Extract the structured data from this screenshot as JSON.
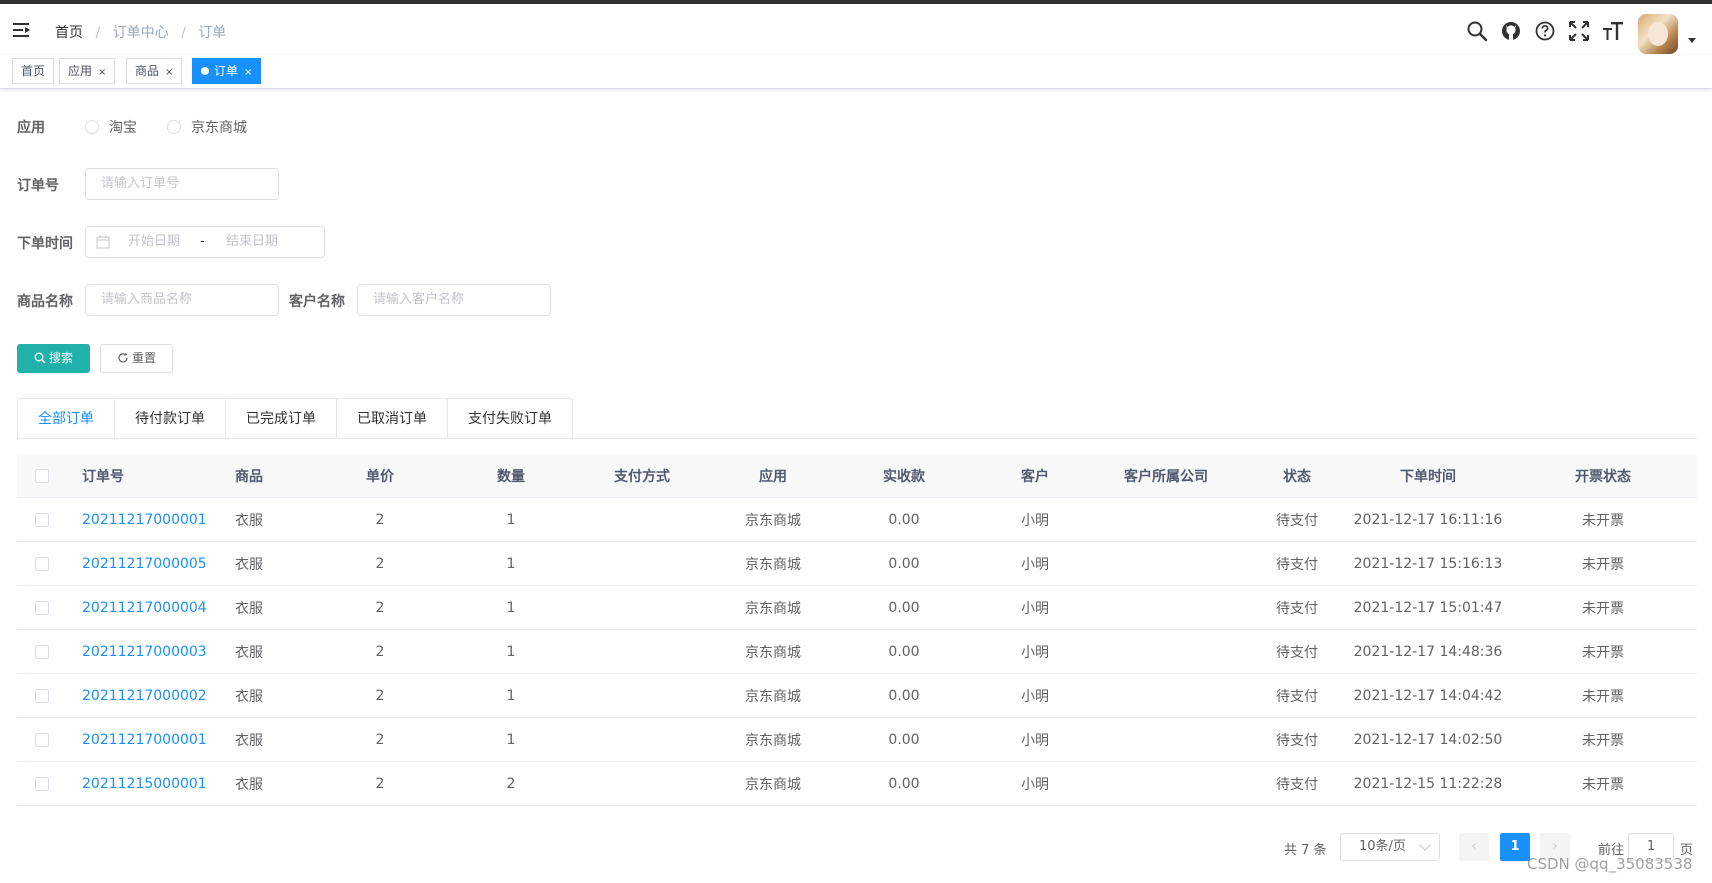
{
  "breadcrumb": [
    "首页",
    "订单中心",
    "订单"
  ],
  "tags": [
    {
      "label": "首页",
      "closable": false,
      "active": false
    },
    {
      "label": "应用",
      "closable": true,
      "active": false
    },
    {
      "label": "商品",
      "closable": true,
      "active": false
    },
    {
      "label": "订单",
      "closable": true,
      "active": true
    }
  ],
  "header_icons": [
    "search-icon",
    "github-icon",
    "help-icon",
    "fullscreen-icon",
    "font-size-icon"
  ],
  "colors": {
    "primary": "#1890ff",
    "search_button": "#20b2aa",
    "active_tag": "#1890ff"
  },
  "form": {
    "app_label": "应用",
    "app_options": [
      "淘宝",
      "京东商城"
    ],
    "order_no_label": "订单号",
    "order_no_placeholder": "请输入订单号",
    "order_time_label": "下单时间",
    "start_date_placeholder": "开始日期",
    "range_separator": "-",
    "end_date_placeholder": "结束日期",
    "product_name_label": "商品名称",
    "product_name_placeholder": "请输入商品名称",
    "customer_name_label": "客户名称",
    "customer_name_placeholder": "请输入客户名称",
    "search_button": "搜索",
    "reset_button": "重置"
  },
  "tabs": [
    "全部订单",
    "待付款订单",
    "已完成订单",
    "已取消订单",
    "支付失败订单"
  ],
  "table": {
    "columns": [
      "订单号",
      "商品",
      "单价",
      "数量",
      "支付方式",
      "应用",
      "实收款",
      "客户",
      "客户所属公司",
      "状态",
      "下单时间",
      "开票状态"
    ],
    "rows": [
      [
        "20211217000001",
        "衣服",
        "2",
        "1",
        "",
        "京东商城",
        "0.00",
        "小明",
        "",
        "待支付",
        "2021-12-17 16:11:16",
        "未开票"
      ],
      [
        "20211217000005",
        "衣服",
        "2",
        "1",
        "",
        "京东商城",
        "0.00",
        "小明",
        "",
        "待支付",
        "2021-12-17 15:16:13",
        "未开票"
      ],
      [
        "20211217000004",
        "衣服",
        "2",
        "1",
        "",
        "京东商城",
        "0.00",
        "小明",
        "",
        "待支付",
        "2021-12-17 15:01:47",
        "未开票"
      ],
      [
        "20211217000003",
        "衣服",
        "2",
        "1",
        "",
        "京东商城",
        "0.00",
        "小明",
        "",
        "待支付",
        "2021-12-17 14:48:36",
        "未开票"
      ],
      [
        "20211217000002",
        "衣服",
        "2",
        "1",
        "",
        "京东商城",
        "0.00",
        "小明",
        "",
        "待支付",
        "2021-12-17 14:04:42",
        "未开票"
      ],
      [
        "20211217000001",
        "衣服",
        "2",
        "1",
        "",
        "京东商城",
        "0.00",
        "小明",
        "",
        "待支付",
        "2021-12-17 14:02:50",
        "未开票"
      ],
      [
        "20211215000001",
        "衣服",
        "2",
        "2",
        "",
        "京东商城",
        "0.00",
        "小明",
        "",
        "待支付",
        "2021-12-15 11:22:28",
        "未开票"
      ]
    ]
  },
  "pagination": {
    "total_text": "共 7 条",
    "page_size": "10条/页",
    "current_page": "1",
    "goto_label": "前往",
    "goto_value": "1",
    "page_suffix": "页"
  },
  "watermark": "CSDN @qq_35083538"
}
